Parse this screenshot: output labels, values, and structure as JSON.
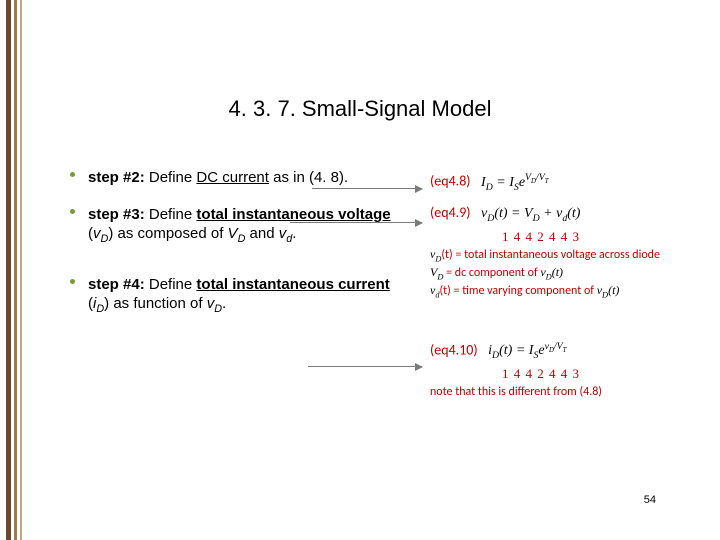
{
  "title": "4. 3. 7. Small-Signal Model",
  "bullets": {
    "b1": {
      "lead": "step #2:",
      "rest_a": " Define ",
      "u": "DC current",
      "rest_b": " as in (4. 8)."
    },
    "b2": {
      "lead": "step #3:",
      "rest_a": " Define ",
      "u": "total instantaneous voltage",
      "paren_open": " (",
      "var": "v",
      "varsub": "D",
      "paren_close": ") as composed of ",
      "var2": "V",
      "var2sub": "D",
      "mid": " and ",
      "var3": "v",
      "var3sub": "d",
      "end": "."
    },
    "b3": {
      "lead": "step #4:",
      "rest_a": " Define ",
      "u": "total instantaneous current",
      "paren_open": " (",
      "var": "i",
      "varsub": "D",
      "mid": ") as function of ",
      "var2": "v",
      "var2sub": "D",
      "end": "."
    }
  },
  "eqs": {
    "eq48_label": "(eq4.8)",
    "eq48_lhs_a": "I",
    "eq48_lhs_sub": "D",
    "eq48_eq": " = ",
    "eq48_rhs_a": "I",
    "eq48_rhs_sub": "S",
    "eq48_rhs_b": "e",
    "eq48_exp_a": "V",
    "eq48_exp_asub": "D",
    "eq48_exp_mid": "/",
    "eq48_exp_b": "V",
    "eq48_exp_bsub": "T",
    "eq49_label": "(eq4.9)",
    "eq49_lhs_a": "v",
    "eq49_lhs_sub": "D",
    "eq49_lhs_t": "(t) = ",
    "eq49_r1a": "V",
    "eq49_r1sub": "D",
    "eq49_plus": " + ",
    "eq49_r2a": "v",
    "eq49_r2sub": "d",
    "eq49_r2t": "(t)",
    "eq49_brace": "1 4 4 2 4 4 3",
    "note_a": "v",
    "note_asub": "D",
    "note_at": "(t) = total instantaneous voltage across diode",
    "note_b": "V",
    "note_bsub": "D",
    "note_bt": " = dc component of ",
    "note_bvar": "v",
    "note_bvarsub": "D",
    "note_btail": "(t)",
    "note_c": "v",
    "note_csub": "d",
    "note_ct": "(t) = time varying component of ",
    "note_cvar": "v",
    "note_cvarsub": "D",
    "note_ctail": "(t)",
    "eq410_label": "(eq4.10)",
    "eq410_lhs_a": "i",
    "eq410_lhs_sub": "D",
    "eq410_lhs_t": "(t) = ",
    "eq410_rhs_a": "I",
    "eq410_rhs_sub": "S",
    "eq410_rhs_b": "e",
    "eq410_exp_a": "v",
    "eq410_exp_asub": "D",
    "eq410_exp_mid": "/",
    "eq410_exp_b": "V",
    "eq410_exp_bsub": "T",
    "eq410_brace": "1 4 4 2 4 4 3",
    "note2": "note that this is different from (4.8)"
  },
  "page_num": "54"
}
